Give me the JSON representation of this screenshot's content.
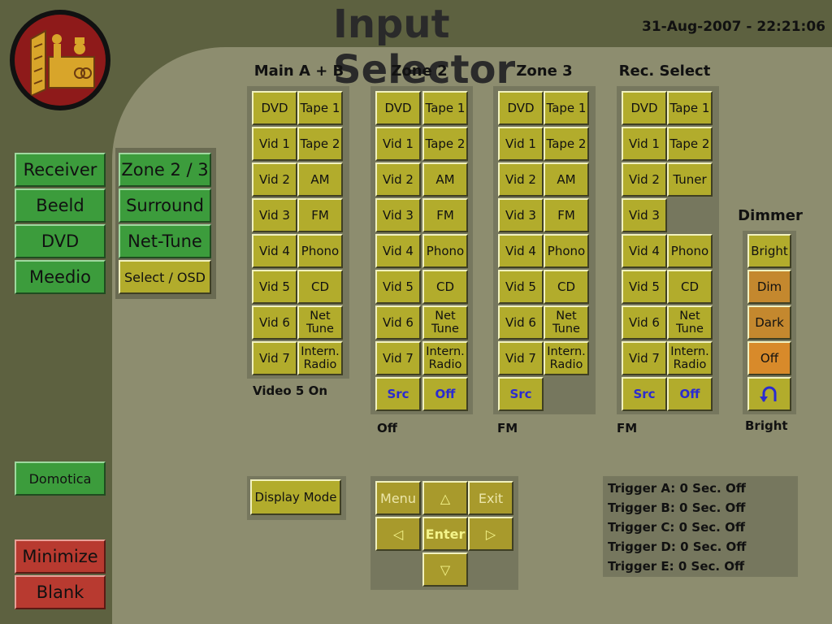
{
  "app": {
    "title": "Input Selector",
    "datetime": "31-Aug-2007 - 22:21:06"
  },
  "sidebar": {
    "receiver": "Receiver",
    "beeld": "Beeld",
    "dvd": "DVD",
    "meedio": "Meedio",
    "domotica": "Domotica",
    "minimize": "Minimize",
    "blank": "Blank"
  },
  "submenu": {
    "zone23": "Zone 2 / 3",
    "surround": "Surround",
    "nettune": "Net-Tune",
    "select_osd": "Select / OSD"
  },
  "columns": {
    "main": {
      "title": "Main A + B",
      "left": [
        "DVD",
        "Vid 1",
        "Vid 2",
        "Vid 3",
        "Vid 4",
        "Vid 5",
        "Vid 6",
        "Vid 7"
      ],
      "right": [
        "Tape 1",
        "Tape 2",
        "AM",
        "FM",
        "Phono",
        "CD",
        "Net\nTune",
        "Intern.\nRadio"
      ],
      "status": "Video 5 On"
    },
    "zone2": {
      "title": "Zone 2",
      "left": [
        "DVD",
        "Vid 1",
        "Vid 2",
        "Vid 3",
        "Vid 4",
        "Vid 5",
        "Vid 6",
        "Vid 7"
      ],
      "right": [
        "Tape 1",
        "Tape 2",
        "AM",
        "FM",
        "Phono",
        "CD",
        "Net\nTune",
        "Intern.\nRadio"
      ],
      "src": "Src",
      "off": "Off",
      "status": "Off"
    },
    "zone3": {
      "title": "Zone 3",
      "left": [
        "DVD",
        "Vid 1",
        "Vid 2",
        "Vid 3",
        "Vid 4",
        "Vid 5",
        "Vid 6",
        "Vid 7"
      ],
      "right": [
        "Tape 1",
        "Tape 2",
        "AM",
        "FM",
        "Phono",
        "CD",
        "Net\nTune",
        "Intern.\nRadio"
      ],
      "src": "Src",
      "status": "FM"
    },
    "rec": {
      "title": "Rec. Select",
      "left": [
        "DVD",
        "Vid 1",
        "Vid 2",
        "Vid 3",
        "Vid 4",
        "Vid 5",
        "Vid 6",
        "Vid 7"
      ],
      "right": [
        "Tape 1",
        "Tape 2",
        "Tuner",
        "Phono",
        "CD",
        "Net\nTune",
        "Intern.\nRadio"
      ],
      "src": "Src",
      "off": "Off",
      "status": "FM"
    }
  },
  "dimmer": {
    "title": "Dimmer",
    "bright": "Bright",
    "dim": "Dim",
    "dark": "Dark",
    "off": "Off",
    "status": "Bright"
  },
  "display_mode": "Display Mode",
  "navpad": {
    "menu": "Menu",
    "exit": "Exit",
    "enter": "Enter",
    "up": "△",
    "down": "▽",
    "left": "◁",
    "right": "▷"
  },
  "triggers": [
    "Trigger A: 0 Sec. Off",
    "Trigger B: 0 Sec. Off",
    "Trigger C: 0 Sec. Off",
    "Trigger D: 0 Sec. Off",
    "Trigger E: 0 Sec. Off"
  ],
  "colors": {
    "background": "#5d6140",
    "panel": "#8d8d6f",
    "button": "#b2ac2c",
    "green_button": "#3c9c3c",
    "red_button": "#b83a30",
    "logo": "#8e1a1a"
  }
}
